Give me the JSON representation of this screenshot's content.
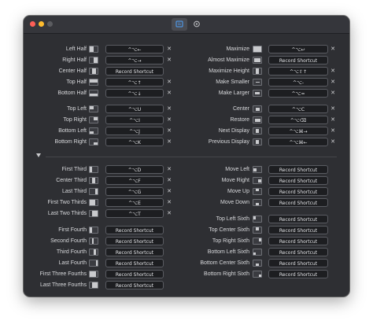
{
  "toolbar": {
    "general_icon": "keyboard-icon",
    "settings_icon": "gear-icon"
  },
  "colors": {
    "window_bg": "#2e2f33",
    "field_bg": "#1d1e21",
    "text": "#d8d9dc"
  },
  "top_left": [
    {
      "label": "Left Half",
      "icon": "left-half",
      "shortcut": "^⌥←",
      "clear": "✕"
    },
    {
      "label": "Right Half",
      "icon": "right-half",
      "shortcut": "^⌥→",
      "clear": "✕"
    },
    {
      "label": "Center Half",
      "icon": "center-half",
      "shortcut": "Record Shortcut",
      "clear": ""
    },
    {
      "label": "Top Half",
      "icon": "top-half",
      "shortcut": "^⌥↑",
      "clear": "✕"
    },
    {
      "label": "Bottom Half",
      "icon": "bottom-half",
      "shortcut": "^⌥↓",
      "clear": "✕"
    },
    {
      "label": "Top Left",
      "icon": "top-left",
      "shortcut": "^⌥U",
      "clear": "✕"
    },
    {
      "label": "Top Right",
      "icon": "top-right",
      "shortcut": "^⌥I",
      "clear": "✕"
    },
    {
      "label": "Bottom Left",
      "icon": "bottom-left",
      "shortcut": "^⌥J",
      "clear": "✕"
    },
    {
      "label": "Bottom Right",
      "icon": "bottom-right",
      "shortcut": "^⌥K",
      "clear": "✕"
    }
  ],
  "top_right": [
    {
      "label": "Maximize",
      "icon": "maximize",
      "shortcut": "^⌥↩",
      "clear": "✕"
    },
    {
      "label": "Almost Maximize",
      "icon": "almost-maximize",
      "shortcut": "Record Shortcut",
      "clear": ""
    },
    {
      "label": "Maximize Height",
      "icon": "maximize-height",
      "shortcut": "^⌥⇧↑",
      "clear": "✕"
    },
    {
      "label": "Make Smaller",
      "icon": "make-smaller",
      "shortcut": "^⌥-",
      "clear": "✕"
    },
    {
      "label": "Make Larger",
      "icon": "make-larger",
      "shortcut": "^⌥=",
      "clear": "✕"
    },
    {
      "label": "Center",
      "icon": "center",
      "shortcut": "^⌥C",
      "clear": "✕"
    },
    {
      "label": "Restore",
      "icon": "restore",
      "shortcut": "^⌥⌫",
      "clear": "✕"
    },
    {
      "label": "Next Display",
      "icon": "next-display",
      "shortcut": "^⌥⌘→",
      "clear": "✕"
    },
    {
      "label": "Previous Display",
      "icon": "previous-display",
      "shortcut": "^⌥⌘←",
      "clear": "✕"
    }
  ],
  "bottom_left": [
    {
      "label": "First Third",
      "icon": "first-third",
      "shortcut": "^⌥D",
      "clear": "✕"
    },
    {
      "label": "Center Third",
      "icon": "center-third",
      "shortcut": "^⌥F",
      "clear": "✕"
    },
    {
      "label": "Last Third",
      "icon": "last-third",
      "shortcut": "^⌥G",
      "clear": "✕"
    },
    {
      "label": "First Two Thirds",
      "icon": "first-two-thirds",
      "shortcut": "^⌥E",
      "clear": "✕"
    },
    {
      "label": "Last Two Thirds",
      "icon": "last-two-thirds",
      "shortcut": "^⌥T",
      "clear": "✕"
    },
    {
      "label": "First Fourth",
      "icon": "first-fourth",
      "shortcut": "Record Shortcut",
      "clear": ""
    },
    {
      "label": "Second Fourth",
      "icon": "second-fourth",
      "shortcut": "Record Shortcut",
      "clear": ""
    },
    {
      "label": "Third Fourth",
      "icon": "third-fourth",
      "shortcut": "Record Shortcut",
      "clear": ""
    },
    {
      "label": "Last Fourth",
      "icon": "last-fourth",
      "shortcut": "Record Shortcut",
      "clear": ""
    },
    {
      "label": "First Three Fourths",
      "icon": "first-three-fourths",
      "shortcut": "Record Shortcut",
      "clear": ""
    },
    {
      "label": "Last Three Fourths",
      "icon": "last-three-fourths",
      "shortcut": "Record Shortcut",
      "clear": ""
    }
  ],
  "bottom_right": [
    {
      "label": "Move Left",
      "icon": "move-left",
      "shortcut": "Record Shortcut",
      "clear": ""
    },
    {
      "label": "Move Right",
      "icon": "move-right",
      "shortcut": "Record Shortcut",
      "clear": ""
    },
    {
      "label": "Move Up",
      "icon": "move-up",
      "shortcut": "Record Shortcut",
      "clear": ""
    },
    {
      "label": "Move Down",
      "icon": "move-down",
      "shortcut": "Record Shortcut",
      "clear": ""
    },
    {
      "label": "Top Left Sixth",
      "icon": "top-left-sixth",
      "shortcut": "Record Shortcut",
      "clear": ""
    },
    {
      "label": "Top Center Sixth",
      "icon": "top-center-sixth",
      "shortcut": "Record Shortcut",
      "clear": ""
    },
    {
      "label": "Top Right Sixth",
      "icon": "top-right-sixth",
      "shortcut": "Record Shortcut",
      "clear": ""
    },
    {
      "label": "Bottom Left Sixth",
      "icon": "bottom-left-sixth",
      "shortcut": "Record Shortcut",
      "clear": ""
    },
    {
      "label": "Bottom Center Sixth",
      "icon": "bottom-center-sixth",
      "shortcut": "Record Shortcut",
      "clear": ""
    },
    {
      "label": "Bottom Right Sixth",
      "icon": "bottom-right-sixth",
      "shortcut": "Record Shortcut",
      "clear": ""
    }
  ]
}
